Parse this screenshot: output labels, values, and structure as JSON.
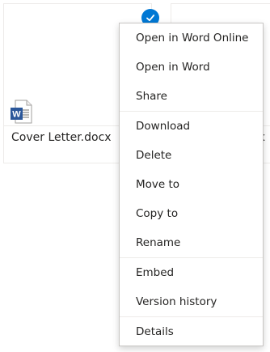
{
  "files": [
    {
      "name": "Cover Letter.docx",
      "type": "word",
      "selected": true
    },
    {
      "name": "x",
      "type": "word",
      "selected": false
    }
  ],
  "accent_color": "#0078d4",
  "context_menu": {
    "groups": [
      [
        "Open in Word Online",
        "Open in Word",
        "Share"
      ],
      [
        "Download",
        "Delete",
        "Move to",
        "Copy to",
        "Rename"
      ],
      [
        "Embed",
        "Version history"
      ],
      [
        "Details"
      ]
    ],
    "items": {
      "open_online": "Open in Word Online",
      "open_word": "Open in Word",
      "share": "Share",
      "download": "Download",
      "delete": "Delete",
      "move_to": "Move to",
      "copy_to": "Copy to",
      "rename": "Rename",
      "embed": "Embed",
      "version_history": "Version history",
      "details": "Details"
    }
  }
}
